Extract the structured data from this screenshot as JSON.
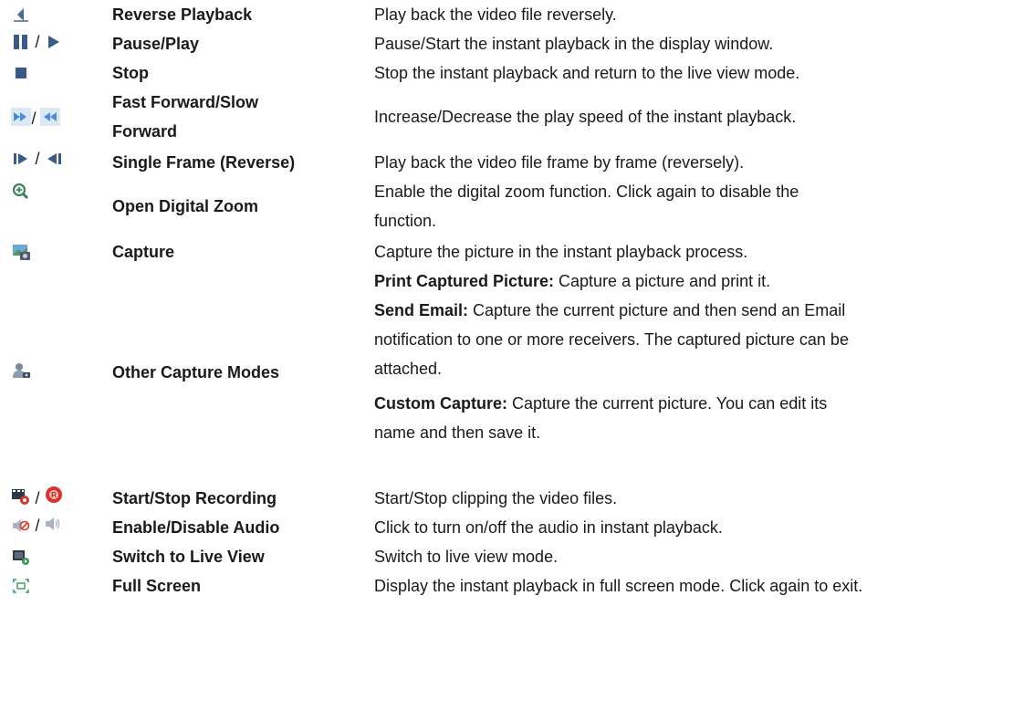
{
  "rows": [
    {
      "name": "Reverse Playback",
      "desc": [
        "Play back the video file reversely."
      ],
      "icons": [
        "reverse-playback-icon"
      ]
    },
    {
      "name": "Pause/Play",
      "desc": [
        "Pause/Start the instant playback in the display window."
      ],
      "icons": [
        "pause-icon",
        "play-icon"
      ]
    },
    {
      "name": "Stop",
      "desc": [
        "Stop the instant playback and return to the live view mode."
      ],
      "icons": [
        "stop-icon"
      ]
    },
    {
      "name": "Fast Forward/Slow Forward",
      "name_lines": [
        "Fast Forward/Slow",
        "Forward"
      ],
      "desc": [
        "Increase/Decrease the play speed of the instant playback."
      ],
      "icons": [
        "fast-forward-icon",
        "slow-forward-icon"
      ]
    },
    {
      "name": "Single Frame (Reverse)",
      "desc": [
        "Play back the video file frame by frame (reversely)."
      ],
      "icons": [
        "single-frame-icon",
        "single-frame-reverse-icon"
      ]
    },
    {
      "name": "Open Digital Zoom",
      "desc_lines": [
        "Enable the digital zoom function. Click again to disable the",
        "function."
      ],
      "icons": [
        "digital-zoom-icon"
      ]
    },
    {
      "name": "Capture",
      "desc": [
        "Capture the picture in the instant playback process."
      ],
      "icons": [
        "capture-icon"
      ]
    },
    {
      "name": "Other Capture Modes",
      "icons": [
        "other-capture-icon"
      ],
      "modes": [
        {
          "label": "Print Captured Picture:",
          "lines": [
            " Capture a picture and print it."
          ]
        },
        {
          "label": "Send Email:",
          "lines": [
            " Capture the current picture and then send an Email",
            "notification to one or more receivers. The captured picture can be",
            "attached."
          ]
        },
        {
          "label": "Custom Capture:",
          "lines": [
            " Capture the current picture. You can edit its",
            "name and then save it."
          ]
        }
      ]
    },
    {
      "name": "Start/Stop Recording",
      "desc": [
        "Start/Stop clipping the video files."
      ],
      "icons": [
        "start-recording-icon",
        "stop-recording-icon"
      ]
    },
    {
      "name": "Enable/Disable Audio",
      "desc": [
        "Click to turn on/off the audio in instant playback."
      ],
      "icons": [
        "audio-off-icon",
        "audio-on-icon"
      ]
    },
    {
      "name": "Switch to Live View",
      "desc": [
        "Switch to live view mode."
      ],
      "icons": [
        "live-view-icon"
      ]
    },
    {
      "name": "Full Screen",
      "desc": [
        "Display the instant playback in full screen mode. Click again to exit."
      ],
      "icons": [
        "full-screen-icon"
      ]
    }
  ],
  "separator": "/",
  "colors": {
    "icon_blue": "#4a8ed8",
    "icon_bg": "#dce8f5",
    "record_red": "#d9332b",
    "zoom_green": "#3a9a58"
  }
}
